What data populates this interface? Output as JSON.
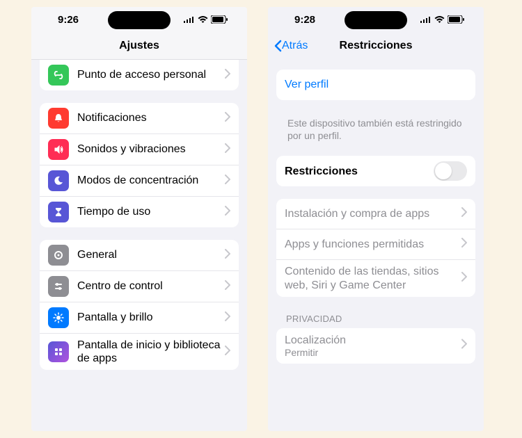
{
  "phone1": {
    "time": "9:26",
    "nav_title": "Ajustes",
    "groups": [
      {
        "partial": true,
        "rows": [
          {
            "name": "hotspot",
            "icon_bg": "#34c759",
            "icon_glyph": "link",
            "label": "Punto de acceso personal"
          }
        ]
      },
      {
        "rows": [
          {
            "name": "notifications",
            "icon_bg": "#ff3b30",
            "icon_glyph": "bell",
            "label": "Notificaciones"
          },
          {
            "name": "sounds",
            "icon_bg": "#ff3b30",
            "icon_glyph": "speaker",
            "label": "Sonidos y vibraciones"
          },
          {
            "name": "focus",
            "icon_bg": "#5856d6",
            "icon_glyph": "moon",
            "label": "Modos de concentración"
          },
          {
            "name": "screen-time",
            "icon_bg": "#5856d6",
            "icon_glyph": "hourglass",
            "label": "Tiempo de uso"
          }
        ]
      },
      {
        "rows": [
          {
            "name": "general",
            "icon_bg": "#8e8e93",
            "icon_glyph": "gear",
            "label": "General"
          },
          {
            "name": "control-center",
            "icon_bg": "#8e8e93",
            "icon_glyph": "slider",
            "label": "Centro de control"
          },
          {
            "name": "display",
            "icon_bg": "#007aff",
            "icon_glyph": "sun",
            "label": "Pantalla y brillo"
          },
          {
            "name": "home-screen",
            "icon_bg": "#3b47c4",
            "icon_glyph": "grid",
            "label": "Pantalla de inicio y biblioteca de apps"
          }
        ]
      }
    ]
  },
  "phone2": {
    "time": "9:28",
    "back_label": "Atrás",
    "nav_title": "Restricciones",
    "profile_link": "Ver perfil",
    "profile_note": "Este dispositivo también está restringido por un perfil.",
    "toggle_label": "Restricciones",
    "restriction_rows": [
      {
        "name": "install-apps",
        "label": "Instalación y compra de apps"
      },
      {
        "name": "allowed-apps",
        "label": "Apps y funciones permitidas"
      },
      {
        "name": "content-stores",
        "label": "Contenido de las tiendas, sitios web, Siri y Game Center"
      }
    ],
    "privacy_header": "PRIVACIDAD",
    "privacy_rows": [
      {
        "name": "location",
        "label": "Localización",
        "detail": "Permitir"
      }
    ]
  }
}
